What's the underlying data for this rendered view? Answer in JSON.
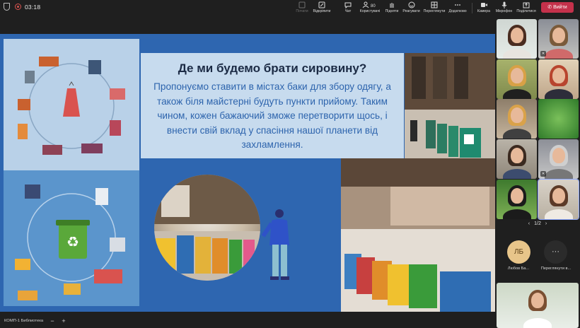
{
  "meeting": {
    "timer": "03:18",
    "leave_label": "Вийти"
  },
  "toolbar": [
    {
      "name": "raise-hand",
      "label": "Почати",
      "icon": "hand-icon",
      "dim": true
    },
    {
      "name": "open",
      "label": "Відкріпити",
      "icon": "unpin-icon",
      "dim": false
    },
    {
      "name": "chat",
      "label": "Чат",
      "icon": "chat-icon",
      "dim": false
    },
    {
      "name": "people",
      "label": "Користувачі",
      "icon": "people-icon",
      "badge": "80",
      "dim": false
    },
    {
      "name": "raise",
      "label": "Підняти",
      "icon": "raise-hand-icon",
      "dim": false
    },
    {
      "name": "react",
      "label": "Реагувати",
      "icon": "smile-icon",
      "dim": false
    },
    {
      "name": "view",
      "label": "Переглянути",
      "icon": "grid-icon",
      "dim": false
    },
    {
      "name": "more",
      "label": "Додатково",
      "icon": "ellipsis-icon",
      "dim": false
    },
    {
      "name": "camera",
      "label": "Камера",
      "icon": "camera-icon",
      "dim": false
    },
    {
      "name": "mic",
      "label": "Мікрофон",
      "icon": "mic-icon",
      "dim": false
    },
    {
      "name": "share",
      "label": "Поділитися",
      "icon": "share-icon",
      "dim": false
    }
  ],
  "slide": {
    "title": "Де ми будемо брати сировину?",
    "body": "Пропонуємо ставити в містах баки для збору одягу, а також біля майстерні будуть пункти прийому. Таким чином, кожен бажаючий зможе перетворити щось, і внести свій вклад у спасіння нашої планети від захламлення."
  },
  "gallery": {
    "pager": "1/2",
    "avatar_initials": "ЛБ",
    "avatar_name": "Любов Ба...",
    "more_name": "Переглянути в...",
    "more_label": "···"
  },
  "bottombar": {
    "label": "КОМП-1 Библиотека",
    "minus": "−",
    "plus": "+"
  },
  "colors": {
    "leave": "#c4314b",
    "slide_bg": "#2e66b0",
    "title": "#1c2b45",
    "body": "#2d64ad"
  }
}
